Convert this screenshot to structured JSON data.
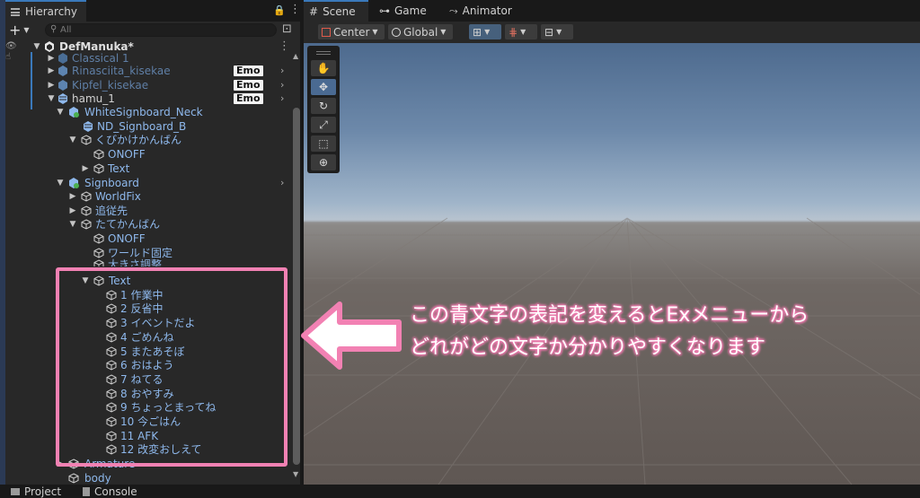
{
  "hierarchy": {
    "tab_label": "Hierarchy",
    "search_placeholder": "All",
    "scene_name": "DefManuka*",
    "emo_badge": "Emo",
    "items": [
      {
        "label": "Classical 1"
      },
      {
        "label": "Rinasciita_kisekae"
      },
      {
        "label": "Kipfel_kisekae"
      },
      {
        "label": "hamu_1"
      },
      {
        "label": "WhiteSignboard_Neck"
      },
      {
        "label": "ND_Signboard_B"
      },
      {
        "label": "くびかけかんばん"
      },
      {
        "label": "ONOFF"
      },
      {
        "label": "Text"
      },
      {
        "label": "Signboard"
      },
      {
        "label": "WorldFix"
      },
      {
        "label": "追従先"
      },
      {
        "label": "たてかんばん"
      },
      {
        "label": "ONOFF"
      },
      {
        "label": "ワールド固定"
      },
      {
        "label": "大きさ調整"
      },
      {
        "label": "Text"
      },
      {
        "label": "1 作業中"
      },
      {
        "label": "2 反省中"
      },
      {
        "label": "3 イベントだよ"
      },
      {
        "label": "4 ごめんね"
      },
      {
        "label": "5 またあそぼ"
      },
      {
        "label": "6 おはよう"
      },
      {
        "label": "7 ねてる"
      },
      {
        "label": "8 おやすみ"
      },
      {
        "label": "9 ちょっとまってね"
      },
      {
        "label": "10 今ごはん"
      },
      {
        "label": "11 AFK"
      },
      {
        "label": "12 改変おしえて"
      },
      {
        "label": "Armature"
      },
      {
        "label": "body"
      }
    ]
  },
  "scene_tabs": {
    "scene": "Scene",
    "game": "Game",
    "animator": "Animator"
  },
  "scene_toolbar": {
    "pivot": "Center",
    "space": "Global"
  },
  "bottom_tabs": {
    "project": "Project",
    "console": "Console"
  },
  "annotation": {
    "line1": "この青文字の表記を変えるとExメニューから",
    "line2": "どれがどの文字か分かりやすくなります"
  },
  "colors": {
    "highlight": "#f281b3",
    "blue_text": "#8eb8ec",
    "panel_bg": "#282828"
  }
}
